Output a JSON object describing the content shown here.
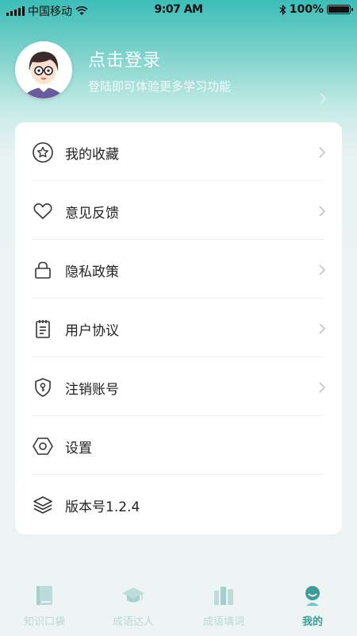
{
  "status_bar": {
    "carrier": "中国移动",
    "time": "9:07 AM",
    "battery": "100%"
  },
  "profile": {
    "title": "点击登录",
    "subtitle": "登陆即可体验更多学习功能"
  },
  "menu": [
    {
      "label": "我的收藏",
      "icon": "star-circle-icon",
      "has_chevron": true
    },
    {
      "label": "意见反馈",
      "icon": "heart-icon",
      "has_chevron": true
    },
    {
      "label": "隐私政策",
      "icon": "lock-icon",
      "has_chevron": true
    },
    {
      "label": "用户协议",
      "icon": "document-icon",
      "has_chevron": true
    },
    {
      "label": "注销账号",
      "icon": "shield-key-icon",
      "has_chevron": true
    },
    {
      "label": "设置",
      "icon": "hexagon-icon",
      "has_chevron": false
    },
    {
      "label": "版本号1.2.4",
      "icon": "layers-icon",
      "has_chevron": false
    }
  ],
  "tabs": [
    {
      "label": "知识口袋",
      "icon": "book-icon",
      "active": false
    },
    {
      "label": "成语达人",
      "icon": "graduation-cap-icon",
      "active": false
    },
    {
      "label": "成语填词",
      "icon": "bookshelf-icon",
      "active": false
    },
    {
      "label": "我的",
      "icon": "user-icon",
      "active": true
    }
  ],
  "colors": {
    "accent": "#3a9e96",
    "header_top": "#3dbdb7",
    "tab_inactive": "#b9d9d6",
    "background": "#eef3f4"
  }
}
